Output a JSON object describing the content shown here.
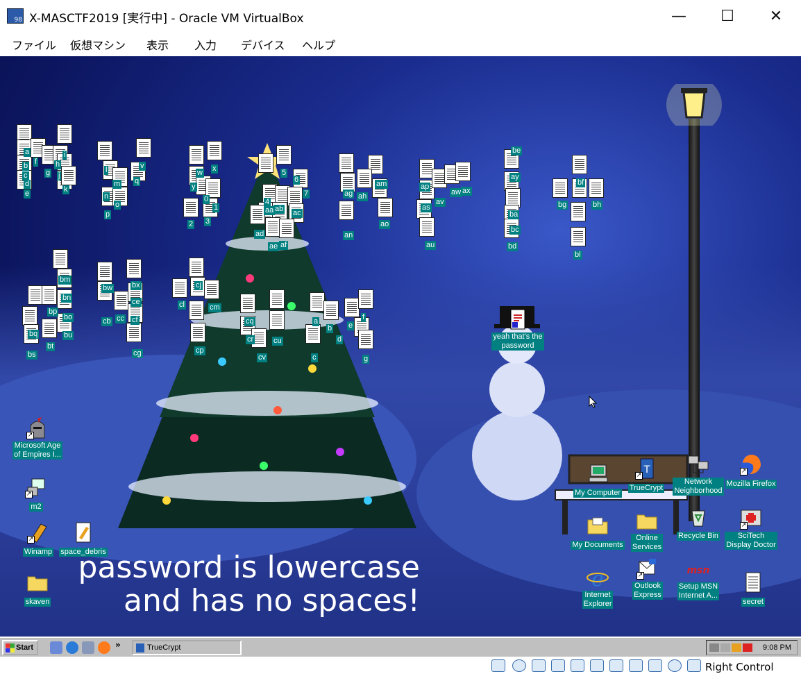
{
  "window": {
    "title": "X-MASCTF2019 [実行中] - Oracle VM VirtualBox",
    "icon_text": "98",
    "minimize": "—",
    "maximize": "☐",
    "close": "✕"
  },
  "menu": [
    "ファイル",
    "仮想マシン",
    "表示",
    "入力",
    "デバイス",
    "ヘルプ"
  ],
  "desktop": {
    "file_labels": [
      "a",
      "b",
      "c",
      "d",
      "e",
      "f",
      "g",
      "h",
      "i",
      "j",
      "k",
      "l",
      "m",
      "n",
      "o",
      "p",
      "q",
      "v",
      "w",
      "x",
      "y",
      "0",
      "1",
      "2",
      "3",
      "4",
      "5",
      "6",
      "7",
      "aa",
      "ab",
      "ac",
      "ad",
      "ae",
      "af",
      "ag",
      "ah",
      "am",
      "an",
      "ao",
      "ap",
      "as",
      "au",
      "av",
      "aw",
      "ax",
      "ay",
      "ba",
      "bc",
      "bd",
      "be",
      "bf",
      "bg",
      "bh",
      "bl",
      "bm",
      "bn",
      "bo",
      "bp",
      "bq",
      "bs",
      "bt",
      "bu",
      "bw",
      "bx",
      "cb",
      "cc",
      "ce",
      "cf",
      "cg",
      "cj",
      "cl",
      "cm",
      "cp",
      "cq",
      "cr",
      "cu",
      "cv"
    ],
    "note_icon": {
      "label_line1": "yeah that's the",
      "label_line2": "password"
    },
    "left_icons": [
      {
        "label_line1": "Microsoft Age",
        "label_line2": "of Empires I..."
      },
      {
        "label_line1": "m2"
      },
      {
        "label_line1": "Winamp"
      },
      {
        "label_line1": "space_debris"
      },
      {
        "label_line1": "skaven"
      }
    ],
    "right_icons": {
      "my_computer": "My Computer",
      "truecrypt": "TrueCrypt",
      "network_line1": "Network",
      "network_line2": "Neighborhood",
      "firefox": "Mozilla Firefox",
      "my_documents": "My Documents",
      "online_line1": "Online",
      "online_line2": "Services",
      "recycle": "Recycle Bin",
      "scitech_line1": "SciTech",
      "scitech_line2": "Display Doctor",
      "ie_line1": "Internet",
      "ie_line2": "Explorer",
      "outlook_line1": "Outlook",
      "outlook_line2": "Express",
      "msn_line1": "Setup MSN",
      "msn_line2": "Internet A...",
      "msn_logo": "msn",
      "secret": "secret"
    },
    "wallpaper_text_line1": "password is lowercase",
    "wallpaper_text_line2": "and has no spaces!"
  },
  "taskbar": {
    "start": "Start",
    "chevron": "»",
    "task": "TrueCrypt",
    "clock": "9:08 PM"
  },
  "statusbar": {
    "host_key": "Right Control"
  }
}
